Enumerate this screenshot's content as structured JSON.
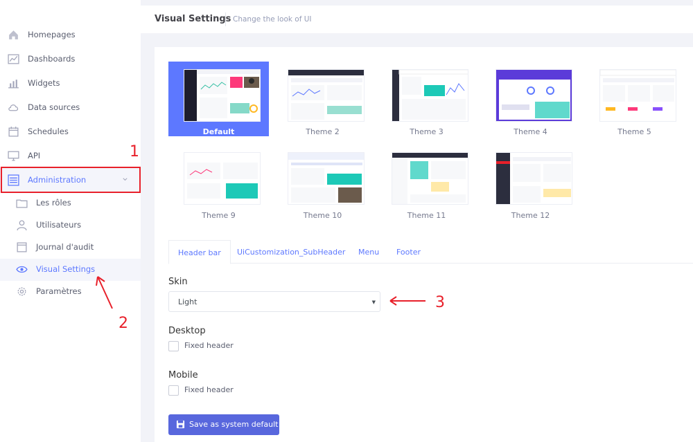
{
  "sidebar": {
    "items": [
      {
        "label": "Homepages",
        "icon": "house-icon"
      },
      {
        "label": "Dashboards",
        "icon": "chart-icon"
      },
      {
        "label": "Widgets",
        "icon": "bar-chart-icon"
      },
      {
        "label": "Data sources",
        "icon": "cloud-icon"
      },
      {
        "label": "Schedules",
        "icon": "calendar-icon"
      },
      {
        "label": "API",
        "icon": "monitor-icon"
      },
      {
        "label": "Administration",
        "icon": "sliders-icon"
      }
    ],
    "sub_items": [
      {
        "label": "Les rôles",
        "icon": "folder-icon"
      },
      {
        "label": "Utilisateurs",
        "icon": "user-icon"
      },
      {
        "label": "Journal d'audit",
        "icon": "book-icon"
      },
      {
        "label": "Visual Settings",
        "icon": "eye-icon"
      },
      {
        "label": "Paramètres",
        "icon": "gear-icon"
      }
    ]
  },
  "subheader": {
    "title": "Visual Settings",
    "description": "Change the look of UI"
  },
  "themes": [
    {
      "name": "Default",
      "selected": true
    },
    {
      "name": "Theme 2"
    },
    {
      "name": "Theme 3"
    },
    {
      "name": "Theme 4"
    },
    {
      "name": "Theme 5"
    },
    {
      "name": "Theme 9"
    },
    {
      "name": "Theme 10"
    },
    {
      "name": "Theme 11"
    },
    {
      "name": "Theme 12"
    }
  ],
  "tabs": [
    "Header bar",
    "UiCustomization_SubHeader",
    "Menu",
    "Footer"
  ],
  "form": {
    "skin_label": "Skin",
    "skin_value": "Light",
    "desktop_label": "Desktop",
    "desktop_fixed_header": "Fixed header",
    "mobile_label": "Mobile",
    "mobile_fixed_header": "Fixed header",
    "save_label": "Save as system default"
  },
  "annotations": [
    "1",
    "2",
    "3"
  ],
  "colors": {
    "accent": "#5d78ff",
    "button": "#5867dd",
    "annotation": "#e8202a"
  }
}
